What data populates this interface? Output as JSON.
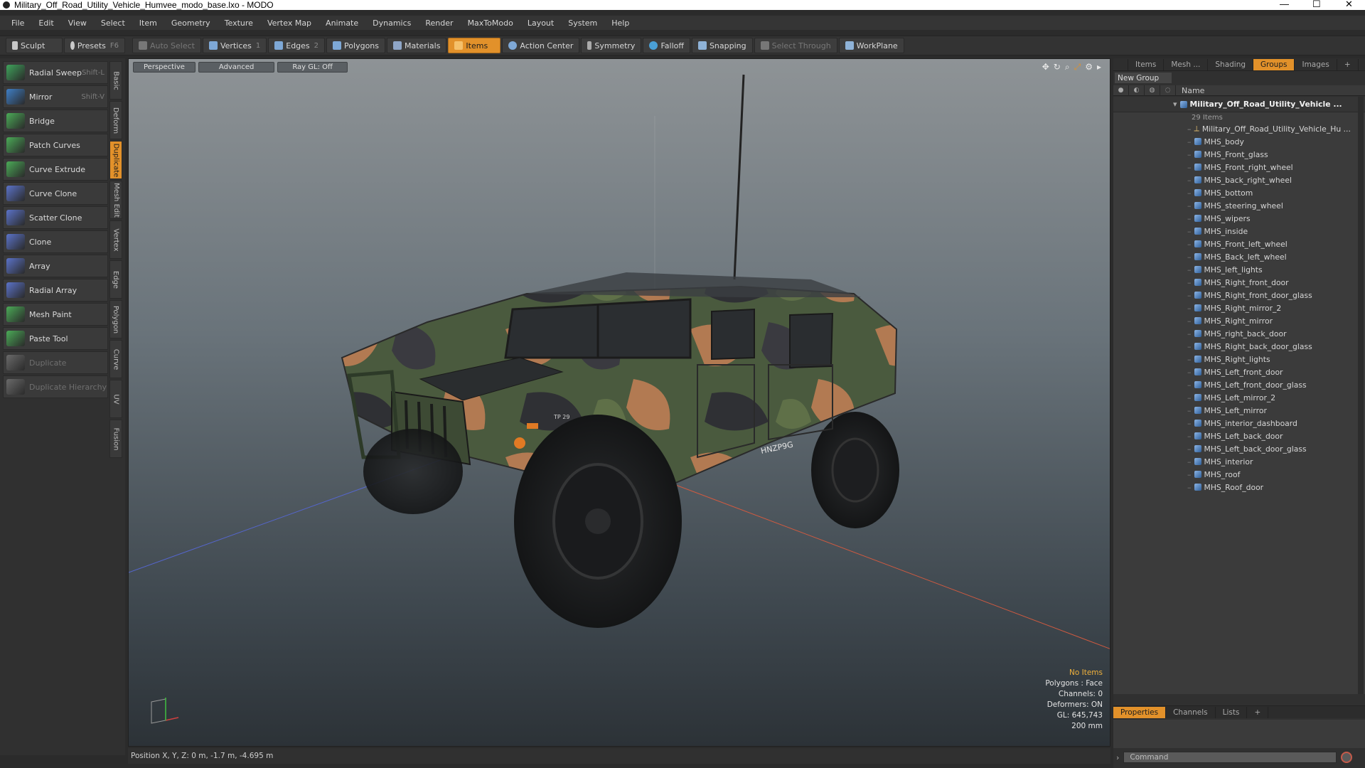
{
  "window": {
    "title": "Military_Off_Road_Utility_Vehicle_Humvee_modo_base.lxo - MODO",
    "minimize": "—",
    "maximize": "☐",
    "close": "✕"
  },
  "menu": [
    "File",
    "Edit",
    "View",
    "Select",
    "Item",
    "Geometry",
    "Texture",
    "Vertex Map",
    "Animate",
    "Dynamics",
    "Render",
    "MaxToModo",
    "Layout",
    "System",
    "Help"
  ],
  "toolbar": {
    "sculpt": "Sculpt",
    "presets": "Presets",
    "presets_key": "F6",
    "auto_select": "Auto Select",
    "vertices": "Vertices",
    "vertices_num": "1",
    "edges": "Edges",
    "edges_num": "2",
    "polygons": "Polygons",
    "materials": "Materials",
    "items": "Items",
    "action_center": "Action Center",
    "symmetry": "Symmetry",
    "falloff": "Falloff",
    "snapping": "Snapping",
    "select_through": "Select Through",
    "workplane": "WorkPlane"
  },
  "left_tools": [
    {
      "label": "Radial Sweep",
      "key": "Shift-L",
      "icon": "radial-sweep-icon",
      "color": "#3fa45b"
    },
    {
      "label": "Mirror",
      "key": "Shift-V",
      "icon": "mirror-icon",
      "color": "#3f7fc6"
    },
    {
      "label": "Bridge",
      "key": "",
      "icon": "bridge-icon",
      "color": "#4bab57"
    },
    {
      "label": "Patch Curves",
      "key": "",
      "icon": "patch-curves-icon",
      "color": "#4bab57"
    },
    {
      "label": "Curve Extrude",
      "key": "",
      "icon": "curve-extrude-icon",
      "color": "#4bab57"
    },
    {
      "label": "Curve Clone",
      "key": "",
      "icon": "curve-clone-icon",
      "color": "#5b73c9"
    },
    {
      "label": "Scatter Clone",
      "key": "",
      "icon": "scatter-clone-icon",
      "color": "#5b73c9"
    },
    {
      "label": "Clone",
      "key": "",
      "icon": "clone-icon",
      "color": "#5b73c9"
    },
    {
      "label": "Array",
      "key": "",
      "icon": "array-icon",
      "color": "#5b73c9"
    },
    {
      "label": "Radial Array",
      "key": "",
      "icon": "radial-array-icon",
      "color": "#5b73c9"
    },
    {
      "label": "Mesh Paint",
      "key": "",
      "icon": "mesh-paint-icon",
      "color": "#4bab57"
    },
    {
      "label": "Paste Tool",
      "key": "",
      "icon": "paste-tool-icon",
      "color": "#4bab57"
    },
    {
      "label": "Duplicate",
      "key": "",
      "icon": "duplicate-icon",
      "color": "#6a6a6a",
      "dim": true
    },
    {
      "label": "Duplicate Hierarchy",
      "key": "",
      "icon": "duplicate-hierarchy-icon",
      "color": "#6a6a6a",
      "dim": true
    }
  ],
  "vertical_tabs": [
    "Basic",
    "Deform",
    "Duplicate",
    "Mesh Edit",
    "Vertex",
    "Edge",
    "Polygon",
    "Curve",
    "UV",
    "Fusion"
  ],
  "active_vertical_tab": "Duplicate",
  "viewport": {
    "view_mode": "Perspective",
    "advanced": "Advanced",
    "raygl": "Ray GL: Off",
    "hud": {
      "selection": "No Items",
      "polygons": "Polygons : Face",
      "channels": "Channels: 0",
      "deformers": "Deformers: ON",
      "gl": "GL: 645,743",
      "scale": "200 mm"
    },
    "license_plate": "HNZP9G",
    "bumper_marking": "TP 29"
  },
  "status": {
    "position": "Position X, Y, Z:  0 m, -1.7 m, -4.695 m"
  },
  "right_tabs": [
    "Items",
    "Mesh ...",
    "Shading",
    "Groups",
    "Images"
  ],
  "right_tabs_active": "Groups",
  "new_group": "New Group",
  "column_name": "Name",
  "group": {
    "name": "Military_Off_Road_Utility_Vehicle ...",
    "count": "29 Items",
    "locator": "Military_Off_Road_Utility_Vehicle_Hu ..."
  },
  "items": [
    "MHS_body",
    "MHS_Front_glass",
    "MHS_Front_right_wheel",
    "MHS_back_right_wheel",
    "MHS_bottom",
    "MHS_steering_wheel",
    "MHS_wipers",
    "MHS_inside",
    "MHS_Front_left_wheel",
    "MHS_Back_left_wheel",
    "MHS_left_lights",
    "MHS_Right_front_door",
    "MHS_Right_front_door_glass",
    "MHS_Right_mirror_2",
    "MHS_Right_mirror",
    "MHS_right_back_door",
    "MHS_Right_back_door_glass",
    "MHS_Right_lights",
    "MHS_Left_front_door",
    "MHS_Left_front_door_glass",
    "MHS_Left_mirror_2",
    "MHS_Left_mirror",
    "MHS_interior_dashboard",
    "MHS_Left_back_door",
    "MHS_Left_back_door_glass",
    "MHS_interior",
    "MHS_roof",
    "MHS_Roof_door"
  ],
  "bottom_tabs": [
    "Properties",
    "Channels",
    "Lists"
  ],
  "bottom_tabs_active": "Properties",
  "command_placeholder": "Command"
}
